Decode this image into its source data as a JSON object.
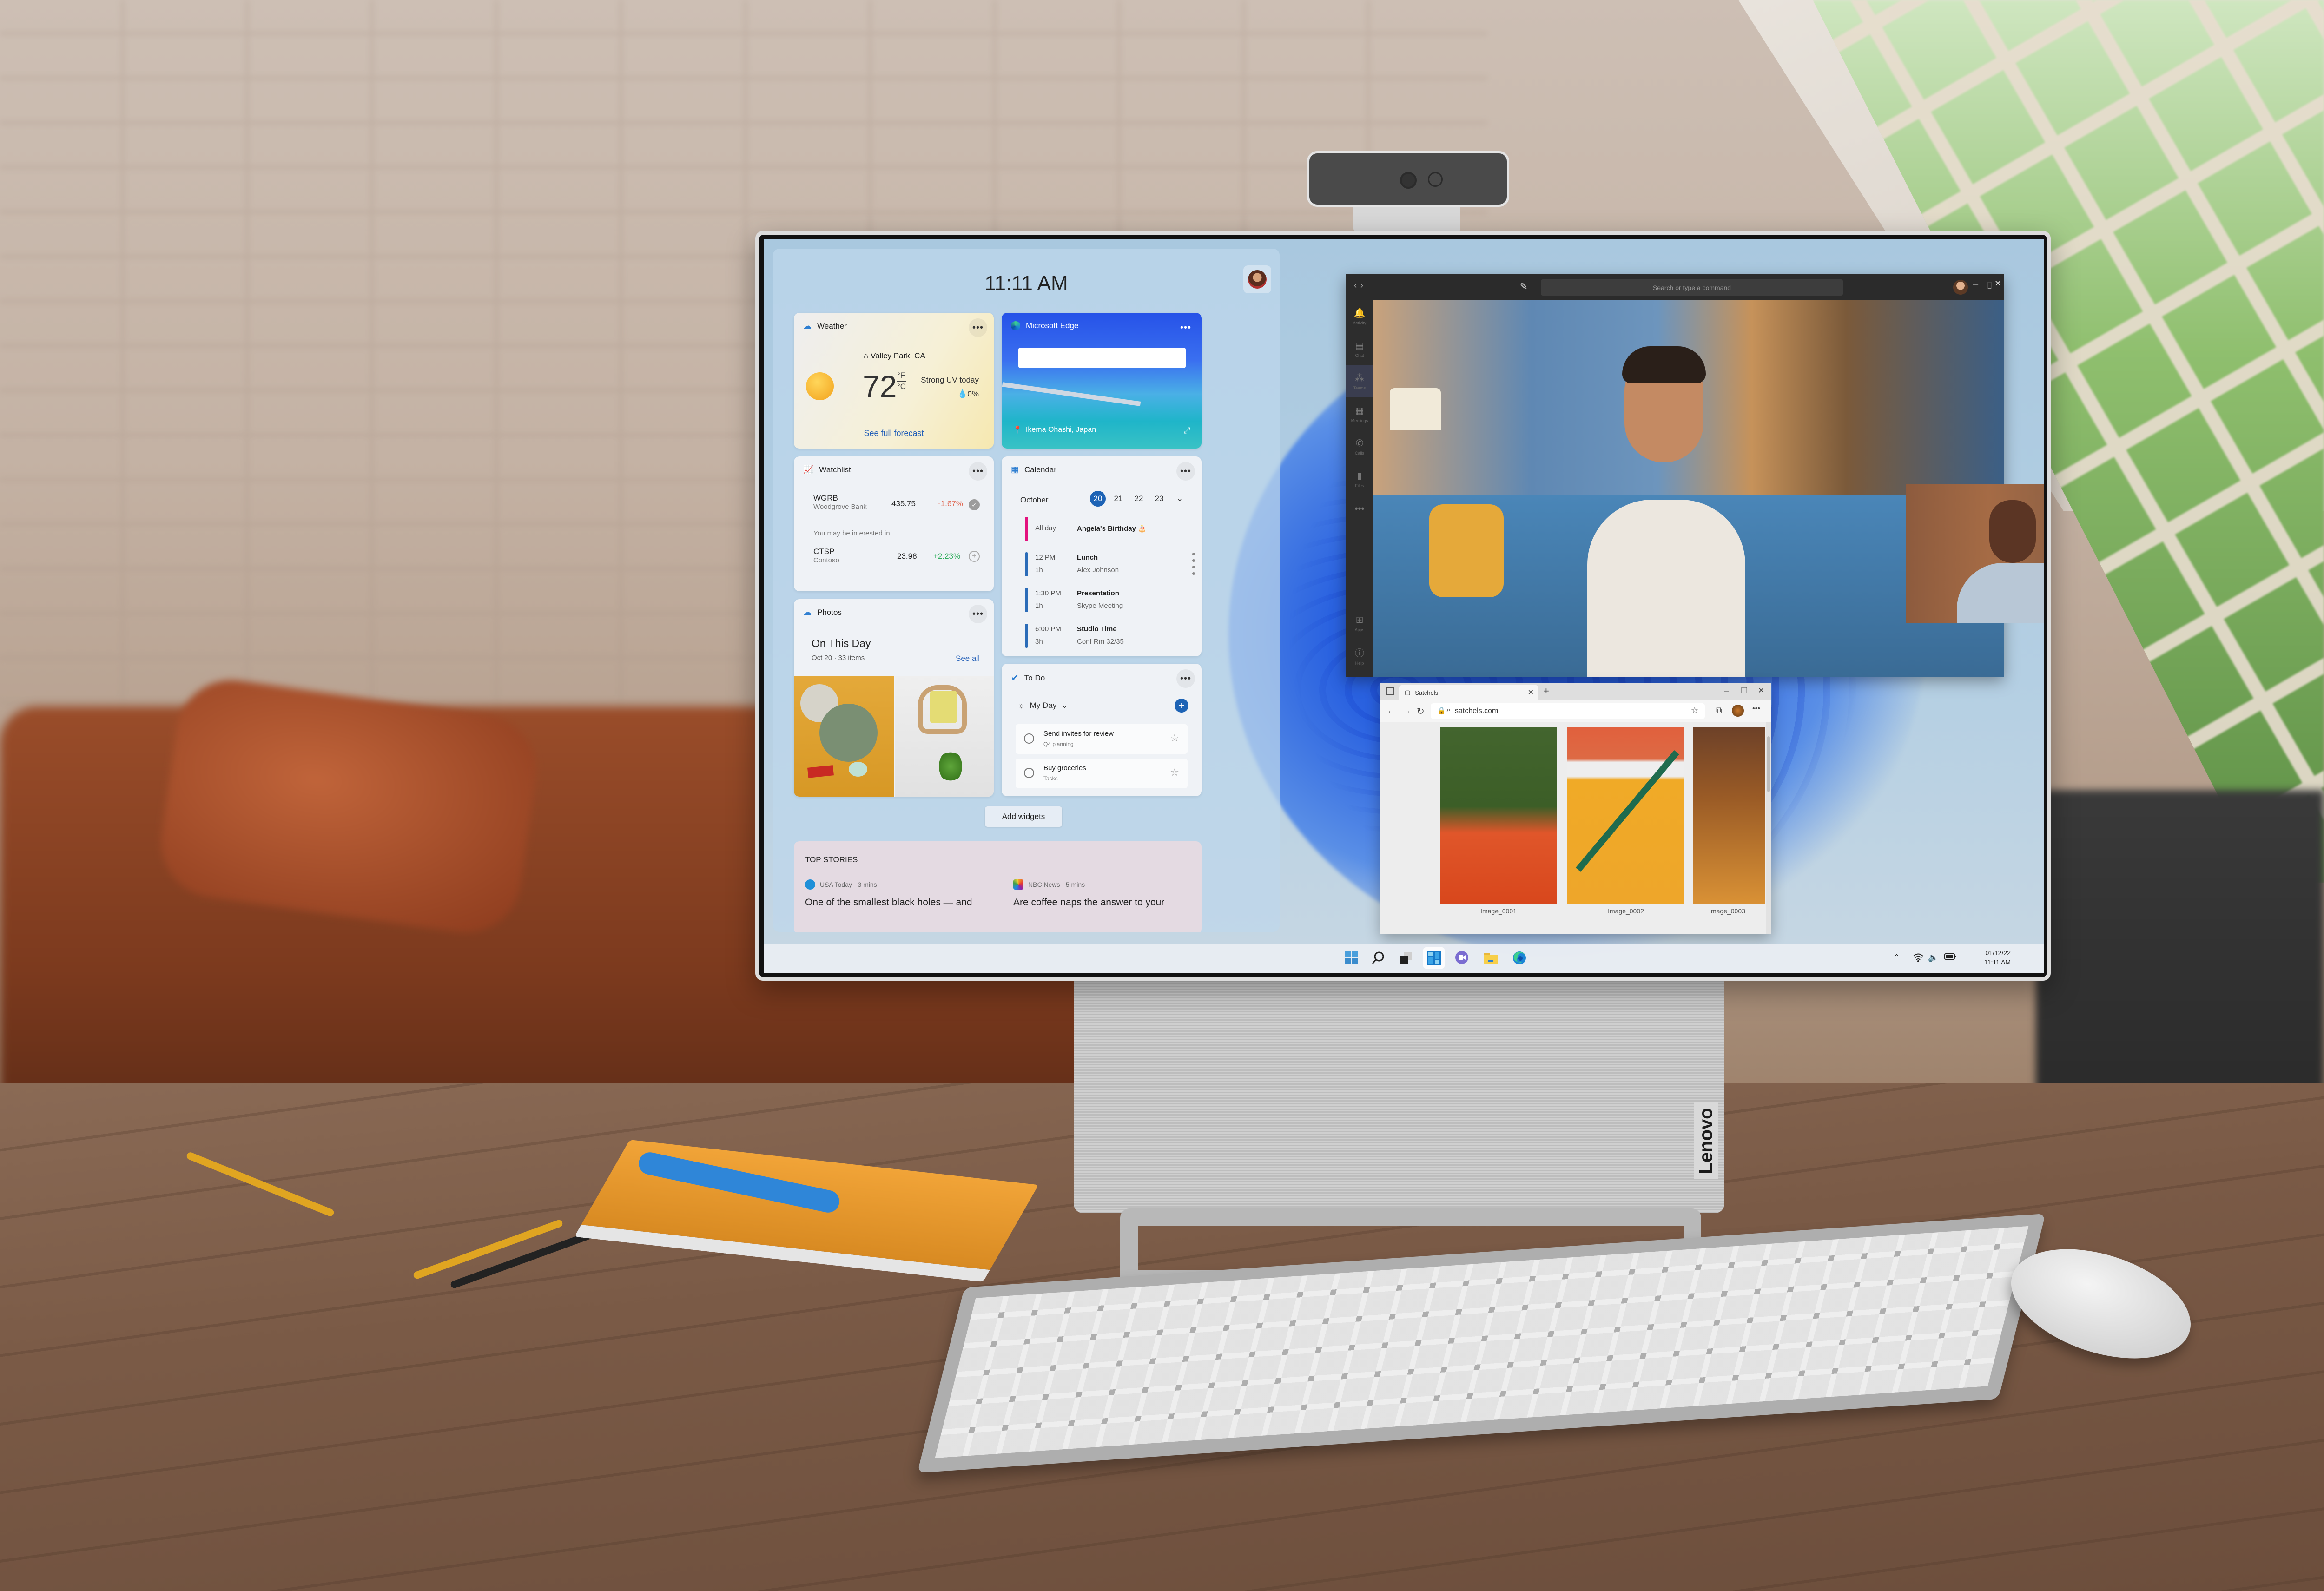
{
  "device": {
    "brand_label": "Lenovo"
  },
  "widgets_panel": {
    "time": "11:11 AM",
    "weather": {
      "title": "Weather",
      "more_label": "•••",
      "location": "Valley Park, CA",
      "temperature": "72",
      "unit_f": "°F",
      "unit_c": "°C",
      "condition": "Strong UV today",
      "precipitation": "0%",
      "link": "See full forecast"
    },
    "edge": {
      "title": "Microsoft Edge",
      "more_label": "•••",
      "search_placeholder": "",
      "location": "Ikema Ohashi, Japan",
      "expand_icon": "⤢"
    },
    "watchlist": {
      "title": "Watchlist",
      "more_label": "•••",
      "stocks": [
        {
          "symbol": "WGRB",
          "name": "Woodgrove Bank",
          "price": "435.75",
          "change": "-1.67%",
          "direction": "down",
          "following": true
        },
        {
          "symbol": "CTSP",
          "name": "Contoso",
          "price": "23.98",
          "change": "+2.23%",
          "direction": "up",
          "following": false
        }
      ],
      "suggestion_label": "You may be interested in"
    },
    "calendar": {
      "title": "Calendar",
      "more_label": "•••",
      "month": "October",
      "days": [
        "20",
        "21",
        "22",
        "23"
      ],
      "selected_day": "20",
      "events": [
        {
          "time": "All day",
          "duration": "",
          "title": "Angela's Birthday 🎂",
          "detail": "",
          "color": "#e3127e"
        },
        {
          "time": "12 PM",
          "duration": "1h",
          "title": "Lunch",
          "detail": "Alex  Johnson",
          "color": "#2b6cb8"
        },
        {
          "time": "1:30 PM",
          "duration": "1h",
          "title": "Presentation",
          "detail": "Skype Meeting",
          "color": "#2b6cb8"
        },
        {
          "time": "6:00 PM",
          "duration": "3h",
          "title": "Studio Time",
          "detail": "Conf Rm 32/35",
          "color": "#2b6cb8"
        }
      ]
    },
    "photos": {
      "title": "Photos",
      "more_label": "•••",
      "heading": "On This Day",
      "subheading": "Oct 20 · 33 items",
      "link": "See all"
    },
    "todo": {
      "title": "To Do",
      "more_label": "•••",
      "list": "My Day",
      "tasks": [
        {
          "title": "Send invites for review",
          "list": "Q4 planning"
        },
        {
          "title": "Buy groceries",
          "list": "Tasks"
        }
      ]
    },
    "add_widgets_label": "Add widgets",
    "top_stories": {
      "heading": "TOP STORIES",
      "stories": [
        {
          "source": "USA Today · 3 mins",
          "headline": "One of the smallest black holes — and"
        },
        {
          "source": "NBC News · 5 mins",
          "headline": "Are coffee naps the answer to your"
        }
      ]
    }
  },
  "teams": {
    "search_placeholder": "Search or type a command",
    "nav_back": "‹",
    "nav_forward": "›",
    "rail": [
      {
        "label": "Activity",
        "icon": "bell-icon",
        "glyph": "🔔",
        "active": false
      },
      {
        "label": "Chat",
        "icon": "chat-icon",
        "glyph": "💬",
        "active": false
      },
      {
        "label": "Teams",
        "icon": "teams-icon",
        "glyph": "👥",
        "active": true
      },
      {
        "label": "Meetings",
        "icon": "calendar-icon",
        "glyph": "📅",
        "active": false
      },
      {
        "label": "Calls",
        "icon": "phone-icon",
        "glyph": "📞",
        "active": false
      },
      {
        "label": "Files",
        "icon": "file-icon",
        "glyph": "📄",
        "active": false
      },
      {
        "label": "",
        "icon": "more-icon",
        "glyph": "•••",
        "active": false
      },
      {
        "label": "Apps",
        "icon": "apps-icon",
        "glyph": "⊞",
        "active": false
      },
      {
        "label": "Help",
        "icon": "help-icon",
        "glyph": "?",
        "active": false
      }
    ]
  },
  "browser": {
    "tab_title": "Satchels",
    "url": "satchels.com",
    "images": [
      {
        "caption": "Image_0001"
      },
      {
        "caption": "Image_0002"
      },
      {
        "caption": "Image_0003"
      }
    ]
  },
  "taskbar": {
    "apps": [
      {
        "name": "start",
        "active": false
      },
      {
        "name": "search",
        "active": false
      },
      {
        "name": "task-view",
        "active": false
      },
      {
        "name": "widgets",
        "active": true
      },
      {
        "name": "teams-chat",
        "active": false
      },
      {
        "name": "file-explorer",
        "active": false
      },
      {
        "name": "edge",
        "active": false
      }
    ],
    "date": "01/12/22",
    "time": "11:11 AM"
  },
  "colors": {
    "accent": "#1d63b5",
    "stock_down": "#e06a55",
    "stock_up": "#2eae5c",
    "link": "#2460b8"
  }
}
